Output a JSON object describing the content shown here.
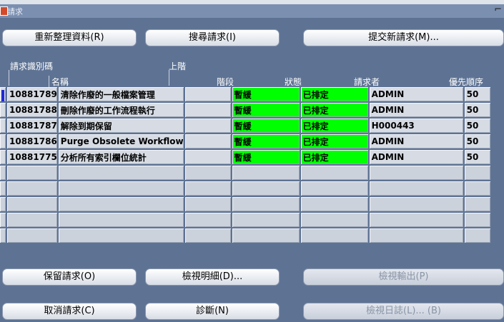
{
  "window": {
    "title": "請求"
  },
  "toolbar": {
    "refresh": "重新整理資料(R)",
    "find": "搜尋請求(I)",
    "submit": "提交新請求(M)..."
  },
  "headers": {
    "request_id": "請求識別碼",
    "parent": "上階",
    "name": "名稱",
    "phase": "階段",
    "status": "狀態",
    "requestor": "請求者",
    "priority": "優先順序"
  },
  "rows": [
    {
      "id": "10881789",
      "name": "清除作廢的一般檔案管理",
      "phase": "暫緩",
      "status": "已排定",
      "requestor": "ADMIN",
      "priority": "50"
    },
    {
      "id": "10881788",
      "name": "刪除作廢的工作流程執行",
      "phase": "暫緩",
      "status": "已排定",
      "requestor": "ADMIN",
      "priority": "50"
    },
    {
      "id": "10881787",
      "name": "解除到期保留",
      "phase": "暫緩",
      "status": "已排定",
      "requestor": "H000443",
      "priority": "50"
    },
    {
      "id": "10881786",
      "name": "Purge Obsolete Workflow",
      "phase": "暫緩",
      "status": "已排定",
      "requestor": "ADMIN",
      "priority": "50"
    },
    {
      "id": "10881775",
      "name": "分析所有索引欄位統計",
      "phase": "暫緩",
      "status": "已排定",
      "requestor": "ADMIN",
      "priority": "50"
    }
  ],
  "bottom": {
    "hold": "保留請求(O)",
    "view_details": "檢視明細(D)...",
    "view_output": "檢視輸出(P)",
    "cancel": "取消請求(C)",
    "diagnose": "診斷(N)",
    "view_log": "檢視日誌(L)... (B)"
  },
  "colors": {
    "phase_status_bg": "#00ff00",
    "window_bg": "#5e7394",
    "selection_marker": "#1f2ad6"
  }
}
